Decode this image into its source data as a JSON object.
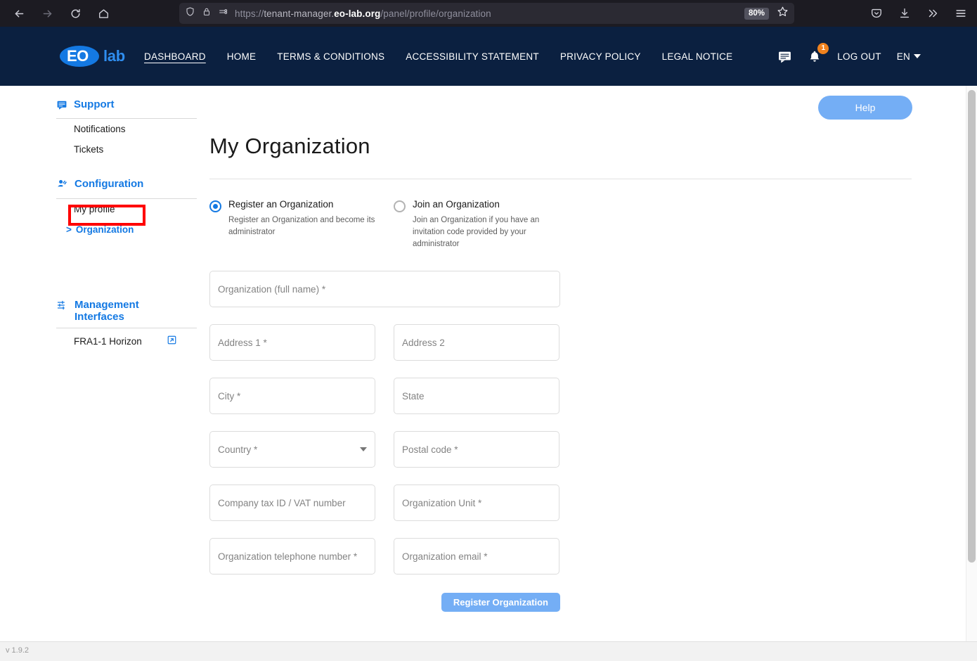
{
  "browser": {
    "url_scheme": "https://",
    "url_host_pre": "tenant-manager.",
    "url_host_bold": "eo-lab.org",
    "url_path": "/panel/profile/organization",
    "zoom_level": "80%",
    "back_icon": "back-arrow-icon",
    "forward_icon": "forward-arrow-icon",
    "reload_icon": "reload-icon",
    "home_icon": "home-icon",
    "shield_icon": "shield-icon",
    "lock_icon": "lock-icon",
    "permissions_icon": "permissions-icon",
    "bookmark_icon": "star-icon",
    "pocket_icon": "pocket-icon",
    "downloads_icon": "downloads-icon",
    "overflow_icon": "chevrons-right-icon",
    "menu_icon": "hamburger-menu-icon"
  },
  "header": {
    "logo_eo": "EO",
    "logo_lab": "lab",
    "nav": [
      {
        "label": "DASHBOARD",
        "active": true
      },
      {
        "label": "HOME",
        "active": false
      },
      {
        "label": "TERMS & CONDITIONS",
        "active": false
      },
      {
        "label": "ACCESSIBILITY STATEMENT",
        "active": false
      },
      {
        "label": "PRIVACY POLICY",
        "active": false
      },
      {
        "label": "LEGAL NOTICE",
        "active": false
      }
    ],
    "message_icon": "message-icon",
    "bell_icon": "bell-icon",
    "notification_count": "1",
    "logout_label": "LOG OUT",
    "language": "EN",
    "badge_color": "#f0821e",
    "bg_color": "#0b2040"
  },
  "sidebar": {
    "groups": [
      {
        "title": "Support",
        "icon": "message-icon",
        "items": [
          {
            "label": "Notifications",
            "active": false
          },
          {
            "label": "Tickets",
            "active": false
          }
        ]
      },
      {
        "title": "Configuration",
        "icon": "user-settings-icon",
        "items": [
          {
            "label": "My profile",
            "active": false
          },
          {
            "label": "Organization",
            "active": true,
            "chevron": ">"
          }
        ]
      },
      {
        "title": "Management Interfaces",
        "icon": "sliders-icon",
        "items": [
          {
            "label": "FRA1-1 Horizon",
            "external": true,
            "icon": "external-link-icon"
          }
        ]
      }
    ],
    "accent_color": "#1479e3",
    "highlight_color": "#ff0000"
  },
  "main": {
    "help_label": "Help",
    "page_title": "My Organization",
    "options": [
      {
        "label": "Register an Organization",
        "description": "Register an Organization and become its administrator",
        "checked": true
      },
      {
        "label": "Join an Organization",
        "description": "Join an Organization if you have an invitation code provided by your administrator",
        "checked": false
      }
    ],
    "form": {
      "org_full_name": {
        "placeholder": "Organization (full name) *",
        "value": ""
      },
      "address1": {
        "placeholder": "Address 1 *",
        "value": ""
      },
      "address2": {
        "placeholder": "Address 2",
        "value": ""
      },
      "city": {
        "placeholder": "City *",
        "value": ""
      },
      "state": {
        "placeholder": "State",
        "value": ""
      },
      "country": {
        "placeholder": "Country *",
        "value": ""
      },
      "postal_code": {
        "placeholder": "Postal code *",
        "value": ""
      },
      "vat": {
        "placeholder": "Company tax ID / VAT number",
        "value": ""
      },
      "org_unit": {
        "placeholder": "Organization Unit *",
        "value": ""
      },
      "phone": {
        "placeholder": "Organization telephone number *",
        "value": ""
      },
      "email": {
        "placeholder": "Organization email *",
        "value": ""
      },
      "submit_label": "Register Organization"
    },
    "button_color": "#74aef5"
  },
  "footer": {
    "version": "v 1.9.2"
  }
}
